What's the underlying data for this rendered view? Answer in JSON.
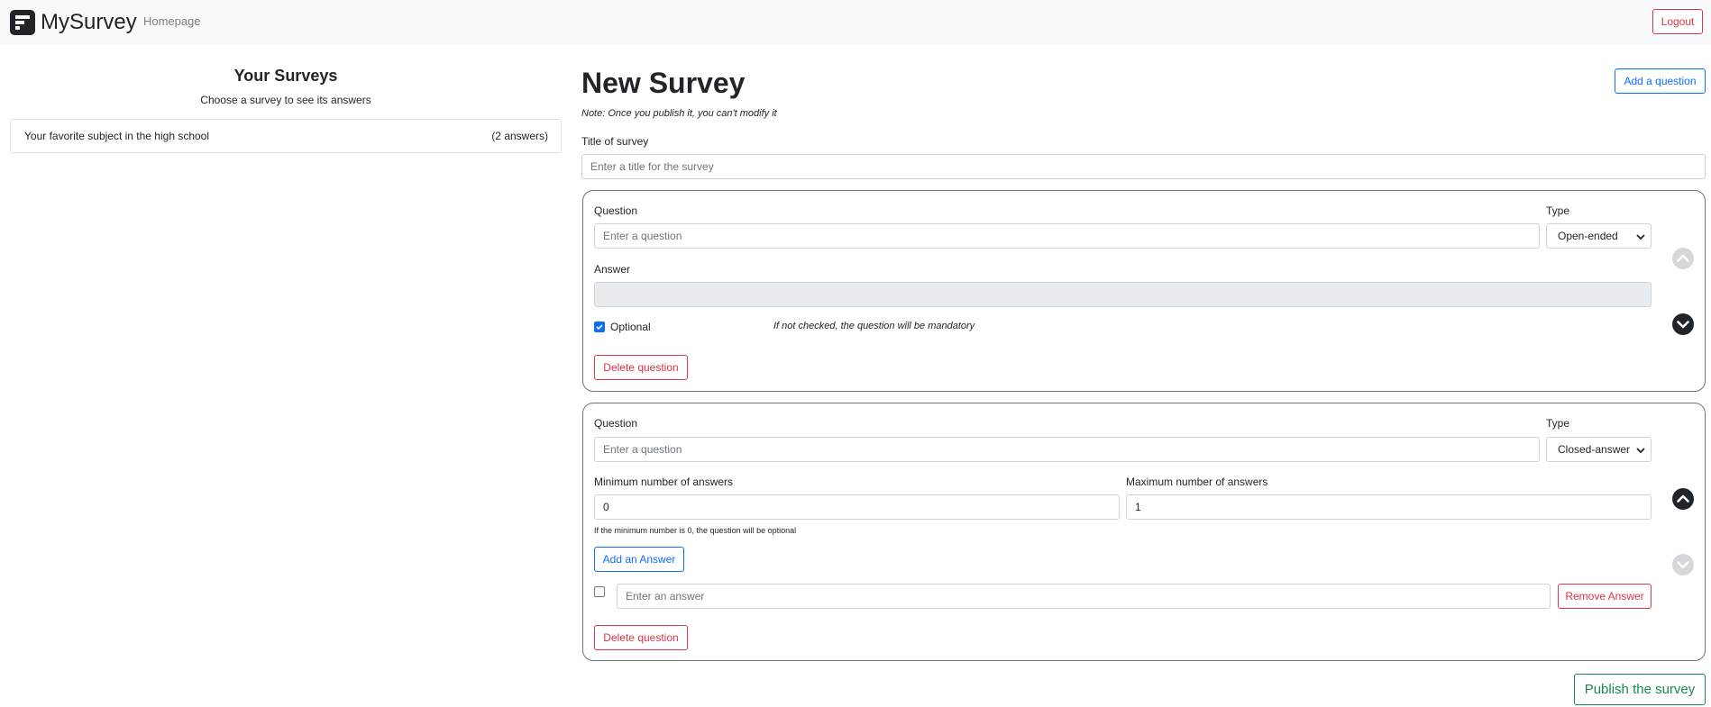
{
  "navbar": {
    "brand": "MySurvey",
    "homepage_link": "Homepage",
    "logout_label": "Logout"
  },
  "sidebar": {
    "title": "Your Surveys",
    "subtitle": "Choose a survey to see its answers",
    "surveys": [
      {
        "name": "Your favorite subject in the high school",
        "answers": "(2 answers)"
      }
    ]
  },
  "main": {
    "title": "New Survey",
    "note": "Note: Once you publish it, you can't modify it",
    "add_question_label": "Add a question",
    "survey_title_label": "Title of survey",
    "survey_title_placeholder": "Enter a title for the survey",
    "publish_label": "Publish the survey"
  },
  "question1": {
    "question_label": "Question",
    "question_placeholder": "Enter a question",
    "type_label": "Type",
    "type_value": "Open-ended",
    "answer_label": "Answer",
    "optional_label": "Optional",
    "optional_checked": true,
    "mandatory_hint": "If not checked, the question will be mandatory",
    "delete_label": "Delete question"
  },
  "question2": {
    "question_label": "Question",
    "question_placeholder": "Enter a question",
    "type_label": "Type",
    "type_value": "Closed-answer",
    "min_label": "Minimum number of answers",
    "min_value": "0",
    "max_label": "Maximum number of answers",
    "max_value": "1",
    "min_hint": "If the minimum number is 0, the question will be optional",
    "add_answer_label": "Add an Answer",
    "answer_placeholder": "Enter an answer",
    "remove_answer_label": "Remove Answer",
    "delete_label": "Delete question"
  },
  "colors": {
    "danger": "#dc3545",
    "primary": "#0d6efd",
    "success": "#198754"
  },
  "icons": [
    "brand-logo-icon",
    "arrow-up-circle-icon",
    "arrow-down-circle-icon",
    "chevron-down-icon"
  ]
}
